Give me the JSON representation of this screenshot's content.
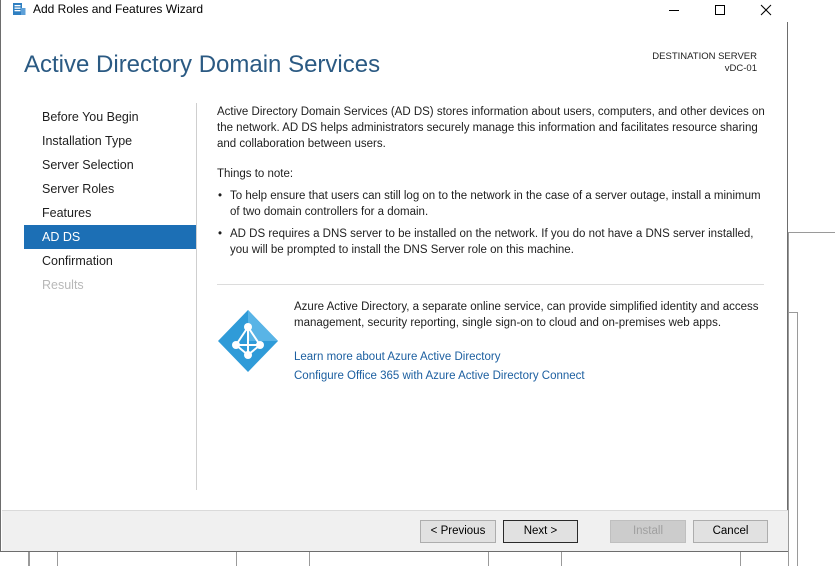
{
  "window": {
    "title": "Add Roles and Features Wizard"
  },
  "header": {
    "title": "Active Directory Domain Services",
    "destination_label": "DESTINATION SERVER",
    "destination_server": "vDC-01"
  },
  "nav": {
    "items": [
      {
        "label": "Before You Begin",
        "state": "normal"
      },
      {
        "label": "Installation Type",
        "state": "normal"
      },
      {
        "label": "Server Selection",
        "state": "normal"
      },
      {
        "label": "Server Roles",
        "state": "normal"
      },
      {
        "label": "Features",
        "state": "normal"
      },
      {
        "label": "AD DS",
        "state": "active"
      },
      {
        "label": "Confirmation",
        "state": "normal"
      },
      {
        "label": "Results",
        "state": "disabled"
      }
    ]
  },
  "content": {
    "intro": "Active Directory Domain Services (AD DS) stores information about users, computers, and other devices on the network.  AD DS helps administrators securely manage this information and facilitates resource sharing and collaboration between users.",
    "notes_heading": "Things to note:",
    "bullet_1": "To help ensure that users can still log on to the network in the case of a server outage, install a minimum of two domain controllers for a domain.",
    "bullet_2": "AD DS requires a DNS server to be installed on the network.  If you do not have a DNS server installed, you will be prompted to install the DNS Server role on this machine.",
    "bullet_glyph": "•",
    "azure_text": "Azure Active Directory, a separate online service, can provide simplified identity and access management, security reporting, single sign-on to cloud and on-premises web apps.",
    "link_1": "Learn more about Azure Active Directory",
    "link_2": "Configure Office 365 with Azure Active Directory Connect"
  },
  "footer": {
    "previous": "< Previous",
    "next": "Next >",
    "install": "Install",
    "cancel": "Cancel"
  },
  "colors": {
    "accent": "#1c6fb5",
    "title_blue": "#2b5a83",
    "link_blue": "#1c5fa0",
    "azure_blue": "#2f9bd8"
  }
}
